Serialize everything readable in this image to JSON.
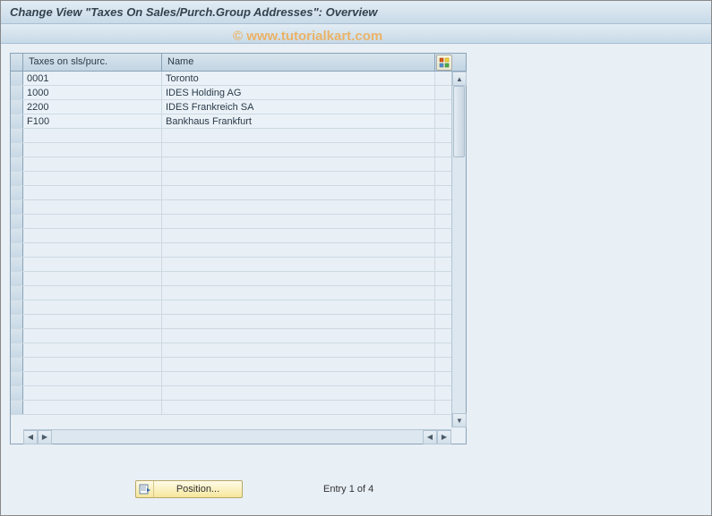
{
  "header": {
    "title": "Change View \"Taxes On Sales/Purch.Group Addresses\": Overview"
  },
  "watermark": "© www.tutorialkart.com",
  "table": {
    "columns": {
      "code": "Taxes on sls/purc.",
      "name": "Name"
    },
    "rows": [
      {
        "code": "0001",
        "name": "Toronto"
      },
      {
        "code": "1000",
        "name": "IDES Holding AG"
      },
      {
        "code": "2200",
        "name": "IDES Frankreich SA"
      },
      {
        "code": "F100",
        "name": "Bankhaus Frankfurt"
      }
    ],
    "empty_rows": 20
  },
  "footer": {
    "position_label": "Position...",
    "entry_text": "Entry 1 of 4"
  }
}
